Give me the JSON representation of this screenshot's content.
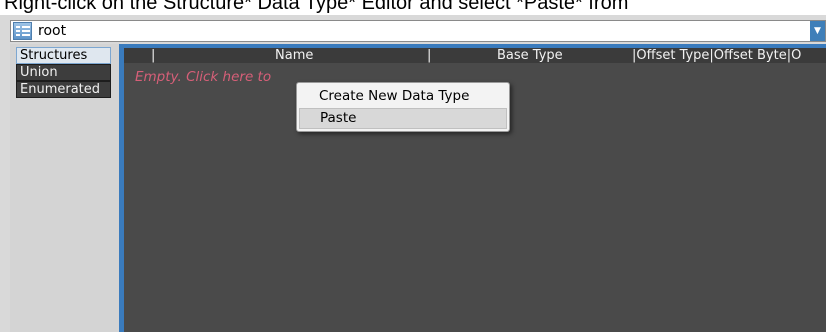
{
  "caption": "Right-click on the Structure* Data Type* Editor and select *Paste* from",
  "path_bar": {
    "value": "root",
    "tree_icon": "tree-view-icon",
    "dropdown_icon": "triangle-down-icon"
  },
  "categories": [
    {
      "label": "Structures",
      "active": true
    },
    {
      "label": "Union",
      "active": false
    },
    {
      "label": "Enumerated",
      "active": false
    }
  ],
  "columns": [
    {
      "label": "|"
    },
    {
      "label": "Name"
    },
    {
      "label": "|"
    },
    {
      "label": "Base Type"
    },
    {
      "label": "|Offset Type|Offset Byte|O"
    }
  ],
  "empty_hint": "Empty. Click here to",
  "context_menu": {
    "items": [
      {
        "label": "Create New Data Type",
        "highlighted": false
      },
      {
        "label": "Paste",
        "highlighted": true
      }
    ]
  },
  "colors": {
    "accent": "#3a7bbd",
    "grid_background": "#4a4a4a",
    "hint_text": "#d65f78"
  }
}
